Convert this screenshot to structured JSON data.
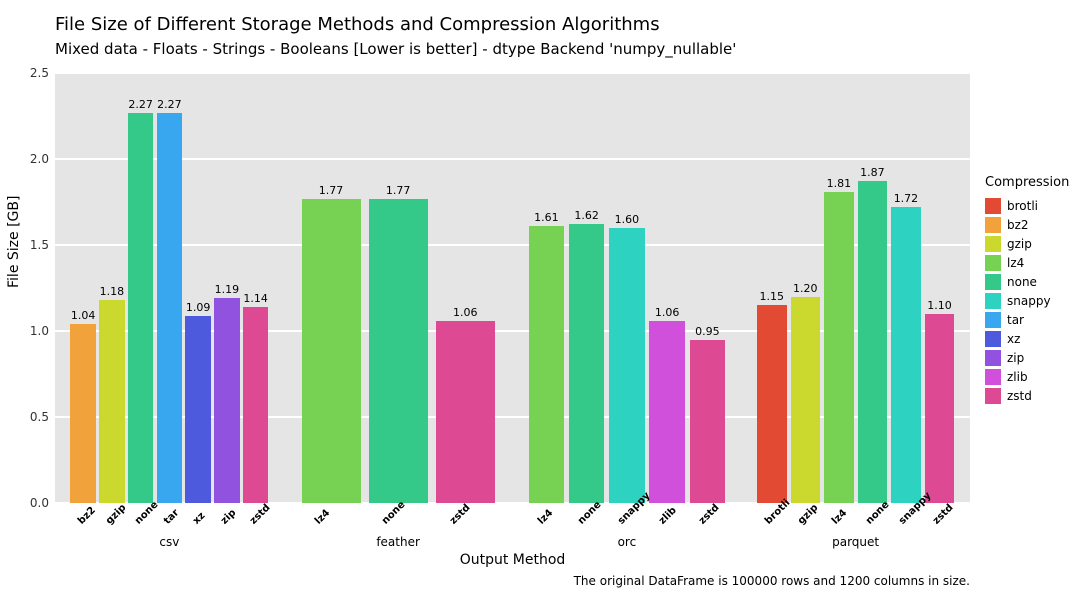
{
  "chart_data": {
    "type": "bar",
    "title": "File Size of Different Storage Methods and Compression Algorithms",
    "subtitle": "Mixed data - Floats - Strings - Booleans [Lower is better] - dtype Backend 'numpy_nullable'",
    "xlabel": "Output Method",
    "ylabel": "File Size [GB]",
    "ylim": [
      0.0,
      2.5
    ],
    "yticks": [
      0.0,
      0.5,
      1.0,
      1.5,
      2.0,
      2.5
    ],
    "caption": "The original DataFrame is 100000 rows and 1200 columns in size.",
    "legend_title": "Compression",
    "legend": [
      {
        "name": "brotli",
        "color": "#e24a33"
      },
      {
        "name": "bz2",
        "color": "#f1a23a"
      },
      {
        "name": "gzip",
        "color": "#cbd92e"
      },
      {
        "name": "lz4",
        "color": "#77d153"
      },
      {
        "name": "none",
        "color": "#35c989"
      },
      {
        "name": "snappy",
        "color": "#2ed2c1"
      },
      {
        "name": "tar",
        "color": "#39a7f0"
      },
      {
        "name": "xz",
        "color": "#4d5ade"
      },
      {
        "name": "zip",
        "color": "#9152e0"
      },
      {
        "name": "zlib",
        "color": "#d050db"
      },
      {
        "name": "zstd",
        "color": "#de4993"
      }
    ],
    "groups": [
      {
        "name": "csv",
        "bars": [
          {
            "label": "bz2",
            "value": 1.04,
            "series": "bz2"
          },
          {
            "label": "gzip",
            "value": 1.18,
            "series": "gzip"
          },
          {
            "label": "none",
            "value": 2.27,
            "series": "none"
          },
          {
            "label": "tar",
            "value": 2.27,
            "series": "tar"
          },
          {
            "label": "xz",
            "value": 1.09,
            "series": "xz"
          },
          {
            "label": "zip",
            "value": 1.19,
            "series": "zip"
          },
          {
            "label": "zstd",
            "value": 1.14,
            "series": "zstd"
          }
        ]
      },
      {
        "name": "feather",
        "bars": [
          {
            "label": "lz4",
            "value": 1.77,
            "series": "lz4"
          },
          {
            "label": "none",
            "value": 1.77,
            "series": "none"
          },
          {
            "label": "zstd",
            "value": 1.06,
            "series": "zstd"
          }
        ]
      },
      {
        "name": "orc",
        "bars": [
          {
            "label": "lz4",
            "value": 1.61,
            "series": "lz4"
          },
          {
            "label": "none",
            "value": 1.62,
            "series": "none"
          },
          {
            "label": "snappy",
            "value": 1.6,
            "series": "snappy"
          },
          {
            "label": "zlib",
            "value": 1.06,
            "series": "zlib"
          },
          {
            "label": "zstd",
            "value": 0.95,
            "series": "zstd"
          }
        ]
      },
      {
        "name": "parquet",
        "bars": [
          {
            "label": "brotli",
            "value": 1.15,
            "series": "brotli"
          },
          {
            "label": "gzip",
            "value": 1.2,
            "series": "gzip"
          },
          {
            "label": "lz4",
            "value": 1.81,
            "series": "lz4"
          },
          {
            "label": "none",
            "value": 1.87,
            "series": "none"
          },
          {
            "label": "snappy",
            "value": 1.72,
            "series": "snappy"
          },
          {
            "label": "zstd",
            "value": 1.1,
            "series": "zstd"
          }
        ]
      }
    ]
  }
}
